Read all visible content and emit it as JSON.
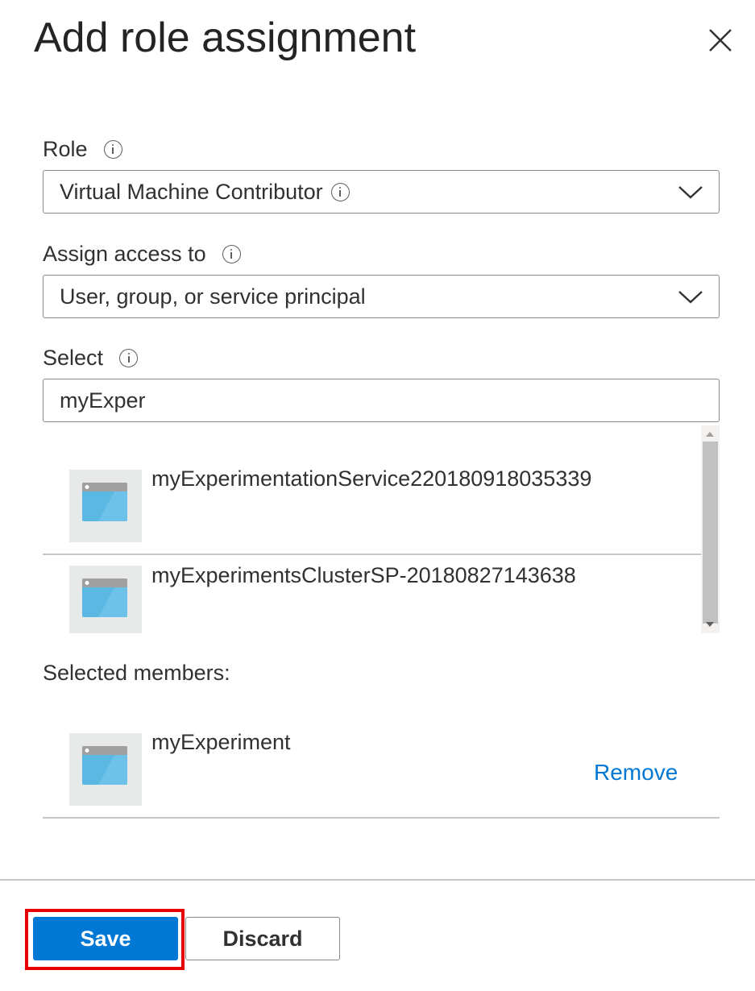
{
  "panel": {
    "title": "Add role assignment"
  },
  "role": {
    "label": "Role",
    "value": "Virtual Machine Contributor"
  },
  "assign_access": {
    "label": "Assign access to",
    "value": "User, group, or service principal"
  },
  "select": {
    "label": "Select",
    "value": "myExper"
  },
  "results": [
    {
      "name": "myExperimentationService220180918035339",
      "icon": "app-registration-icon"
    },
    {
      "name": "myExperimentsClusterSP-20180827143638",
      "icon": "app-registration-icon"
    }
  ],
  "selected_members": {
    "label": "Selected members:",
    "items": [
      {
        "name": "myExperiment",
        "remove_label": "Remove",
        "icon": "app-registration-icon"
      }
    ]
  },
  "footer": {
    "save_label": "Save",
    "discard_label": "Discard"
  },
  "colors": {
    "accent": "#0078d4",
    "highlight": "#e60000",
    "icon_blue": "#5ab8e2",
    "icon_bar": "#a0a0a0",
    "thumb_bg": "#e8e9e9"
  }
}
